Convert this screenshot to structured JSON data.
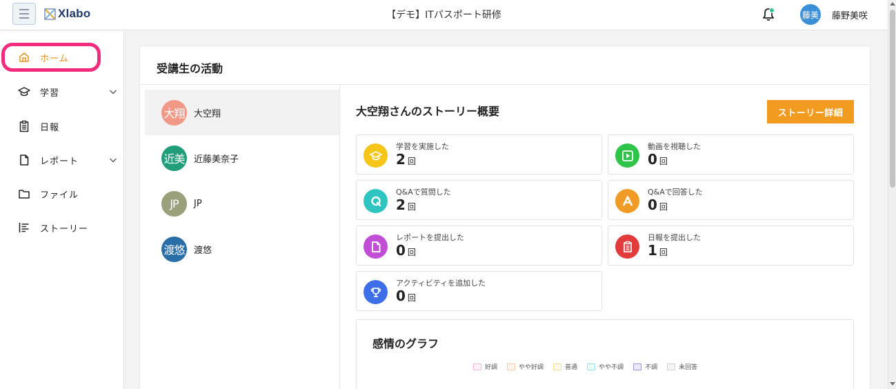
{
  "header": {
    "app_name": "Xlabo",
    "title": "【デモ】ITパスポート研修",
    "user": {
      "avatar_text": "藤美",
      "name": "藤野美咲"
    }
  },
  "sidebar": {
    "items": [
      {
        "label": "ホーム",
        "icon": "home-icon",
        "active": true
      },
      {
        "label": "学習",
        "icon": "graduation-cap-icon",
        "expandable": true
      },
      {
        "label": "日報",
        "icon": "clipboard-icon"
      },
      {
        "label": "レポート",
        "icon": "document-icon",
        "expandable": true
      },
      {
        "label": "ファイル",
        "icon": "folder-icon"
      },
      {
        "label": "ストーリー",
        "icon": "story-list-icon"
      }
    ]
  },
  "main": {
    "title": "受講生の活動",
    "students": [
      {
        "avatar_text": "大翔",
        "name": "大空翔",
        "color": "#f29886"
      },
      {
        "avatar_text": "近美",
        "name": "近藤美奈子",
        "color": "#1f9e79"
      },
      {
        "avatar_text": "JP",
        "name": "JP",
        "color": "#9aa07a"
      },
      {
        "avatar_text": "渡悠",
        "name": "渡悠",
        "color": "#2a6ea8"
      }
    ],
    "story": {
      "title": "大空翔さんのストーリー概要",
      "button_label": "ストーリー詳細",
      "unit": "回",
      "stats": [
        {
          "label": "学習を実施した",
          "value": "2",
          "icon": "graduation-cap-icon",
          "color": "#f5c518"
        },
        {
          "label": "動画を視聴した",
          "value": "0",
          "icon": "play-video-icon",
          "color": "#2ec44a"
        },
        {
          "label": "Q&Aで質問した",
          "value": "2",
          "icon": "question-q-icon",
          "color": "#2ec4c0"
        },
        {
          "label": "Q&Aで回答した",
          "value": "0",
          "icon": "answer-a-icon",
          "color": "#ef9b25"
        },
        {
          "label": "レポートを提出した",
          "value": "0",
          "icon": "report-document-icon",
          "color": "#c04fd6"
        },
        {
          "label": "日報を提出した",
          "value": "1",
          "icon": "daily-report-icon",
          "color": "#e23b3b"
        },
        {
          "label": "アクティビティを追加した",
          "value": "0",
          "icon": "trophy-icon",
          "color": "#3f6fe8"
        }
      ]
    },
    "emotion": {
      "title": "感情のグラフ",
      "legend": [
        {
          "label": "好調",
          "color": "#f7b8e0"
        },
        {
          "label": "やや好調",
          "color": "#f9c8a8"
        },
        {
          "label": "普通",
          "color": "#f8dc90"
        },
        {
          "label": "やや不調",
          "color": "#9fe1ea"
        },
        {
          "label": "不調",
          "color": "#9a90e0"
        },
        {
          "label": "未回答",
          "color": "#cfcfcf"
        }
      ]
    }
  }
}
